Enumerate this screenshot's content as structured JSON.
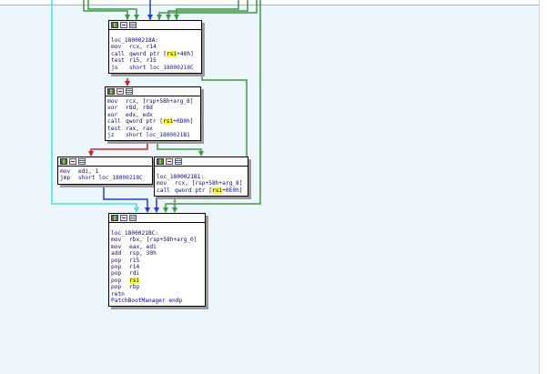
{
  "colors": {
    "canvas_bg": "#edf6fc",
    "edge_green": "#3c9a3c",
    "edge_red": "#d02020",
    "edge_blue": "#1e3cd8",
    "edge_cyan": "#40e0e8",
    "highlight": "#ffff30"
  },
  "icons": [
    "color-palette-icon",
    "graph-view-icon",
    "list-view-icon"
  ],
  "nodes": [
    {
      "id": "block-18A",
      "label": "loc_18000218A:",
      "lines": [
        {
          "m": "mov",
          "pre": "rcx, r14",
          "hl": "",
          "post": ""
        },
        {
          "m": "call",
          "pre": "qword ptr [",
          "hl": "rsi",
          "post": "+48h]"
        },
        {
          "m": "test",
          "pre": "r15, r15",
          "hl": "",
          "post": ""
        },
        {
          "m": "js",
          "pre": "short loc_18000218C",
          "hl": "",
          "post": ""
        }
      ]
    },
    {
      "id": "block-19x",
      "label": "",
      "lines": [
        {
          "m": "mov",
          "pre": "rcx, [rsp+58h+arg_8]",
          "hl": "",
          "post": ""
        },
        {
          "m": "xor",
          "pre": "r8d, r8d",
          "hl": "",
          "post": ""
        },
        {
          "m": "xor",
          "pre": "edx, edx",
          "hl": "",
          "post": ""
        },
        {
          "m": "call",
          "pre": "qword ptr [",
          "hl": "rsi",
          "post": "+0D0h]"
        },
        {
          "m": "test",
          "pre": "rax, rax",
          "hl": "",
          "post": ""
        },
        {
          "m": "jz",
          "pre": "short loc_1800021B1",
          "hl": "",
          "post": ""
        }
      ]
    },
    {
      "id": "block-left",
      "label": "",
      "lines": [
        {
          "m": "mov",
          "pre": "edi, 1",
          "hl": "",
          "post": ""
        },
        {
          "m": "jmp",
          "pre": "short loc_18000218C",
          "hl": "",
          "post": ""
        }
      ]
    },
    {
      "id": "block-1B1",
      "label": "loc_1800021B1:",
      "lines": [
        {
          "m": "mov",
          "pre": "rcx, [rsp+58h+arg_8]",
          "hl": "",
          "post": ""
        },
        {
          "m": "call",
          "pre": "qword ptr [",
          "hl": "rsi",
          "post": "+0E0h]"
        }
      ]
    },
    {
      "id": "block-1BC",
      "label": "loc_1800021BC:",
      "lines": [
        {
          "m": "mov",
          "pre": "rbx, [rsp+58h+arg_0]",
          "hl": "",
          "post": ""
        },
        {
          "m": "mov",
          "pre": "eax, edi",
          "hl": "",
          "post": ""
        },
        {
          "m": "add",
          "pre": "rsp, 30h",
          "hl": "",
          "post": ""
        },
        {
          "m": "pop",
          "pre": "r15",
          "hl": "",
          "post": ""
        },
        {
          "m": "pop",
          "pre": "r14",
          "hl": "",
          "post": ""
        },
        {
          "m": "pop",
          "pre": "rdi",
          "hl": "",
          "post": ""
        },
        {
          "m": "pop",
          "pre": "",
          "hl": "rsi",
          "post": ""
        },
        {
          "m": "pop",
          "pre": "rbp",
          "hl": "",
          "post": ""
        },
        {
          "m": "retn",
          "pre": "",
          "hl": "",
          "post": ""
        }
      ],
      "footer": "PatchBootManager endp"
    }
  ]
}
